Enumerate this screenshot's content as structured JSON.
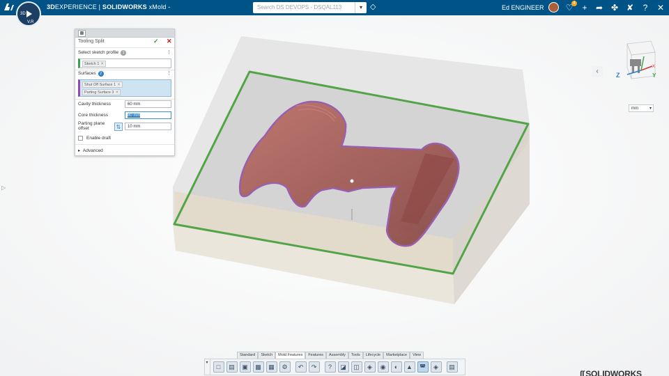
{
  "topbar": {
    "brand_3d": "3D",
    "brand_experience": "EXPERIENCE",
    "brand_sep": " | ",
    "brand_sw": "SOLIDWORKS",
    "brand_app": " xMold -",
    "search_placeholder": "Search DS DEVOPS - DSQAL113",
    "user_name": "Ed ENGINEER",
    "notification_count": "4",
    "compass_quadrant_top": "3D",
    "compass_quadrant_bottom": "V.R",
    "icons": [
      "tag-icon",
      "share-notification-icon",
      "add-icon",
      "share-icon",
      "network-icon",
      "tools-icon",
      "help-icon",
      "compress-icon"
    ]
  },
  "panel": {
    "title": "Tooling Split",
    "sketch_label": "Select sketch profile",
    "sketch_count": "1",
    "sketch_chip": "Sketch 1",
    "surfaces_label": "Surfaces",
    "surfaces_count": "2",
    "surface_chips": [
      "Shut Off Surface 1",
      "Parting Surface 3"
    ],
    "cavity_label": "Cavity thickness",
    "cavity_value": "60 mm",
    "core_label": "Core thickness",
    "core_value": "80 mm",
    "parting_label_1": "Parting plane",
    "parting_label_2": "offset",
    "parting_value": "10 mm",
    "draft_label": "Enable draft",
    "advanced_label": "Advanced"
  },
  "viewport": {
    "units": "mm",
    "brand": "SOLIDWORKS",
    "triad_axes": [
      "Z",
      "X",
      "Y"
    ],
    "colors": {
      "mold_block": "#d9d9d9",
      "parting_outline": "#52a447",
      "part": "#a5564f",
      "surface_outline": "#9a5fae"
    }
  },
  "command_manager": {
    "tabs": [
      "Standard",
      "Sketch",
      "Mold Features",
      "Features",
      "Assembly",
      "Tools",
      "Lifecycle",
      "Marketplace",
      "View"
    ],
    "active_tab": "Mold Features",
    "icons": [
      "new-document-icon",
      "open-icon",
      "save-icon",
      "rebuild-icon",
      "properties-icon",
      "options-icon",
      "undo-icon",
      "redo-icon",
      "help-icon",
      "section-view-icon",
      "view-orientation-icon",
      "display-style-icon",
      "hide-show-icon",
      "appearance-icon",
      "scene-icon",
      "render-icon",
      "parting-line-icon",
      "tooling-split-icon"
    ]
  }
}
